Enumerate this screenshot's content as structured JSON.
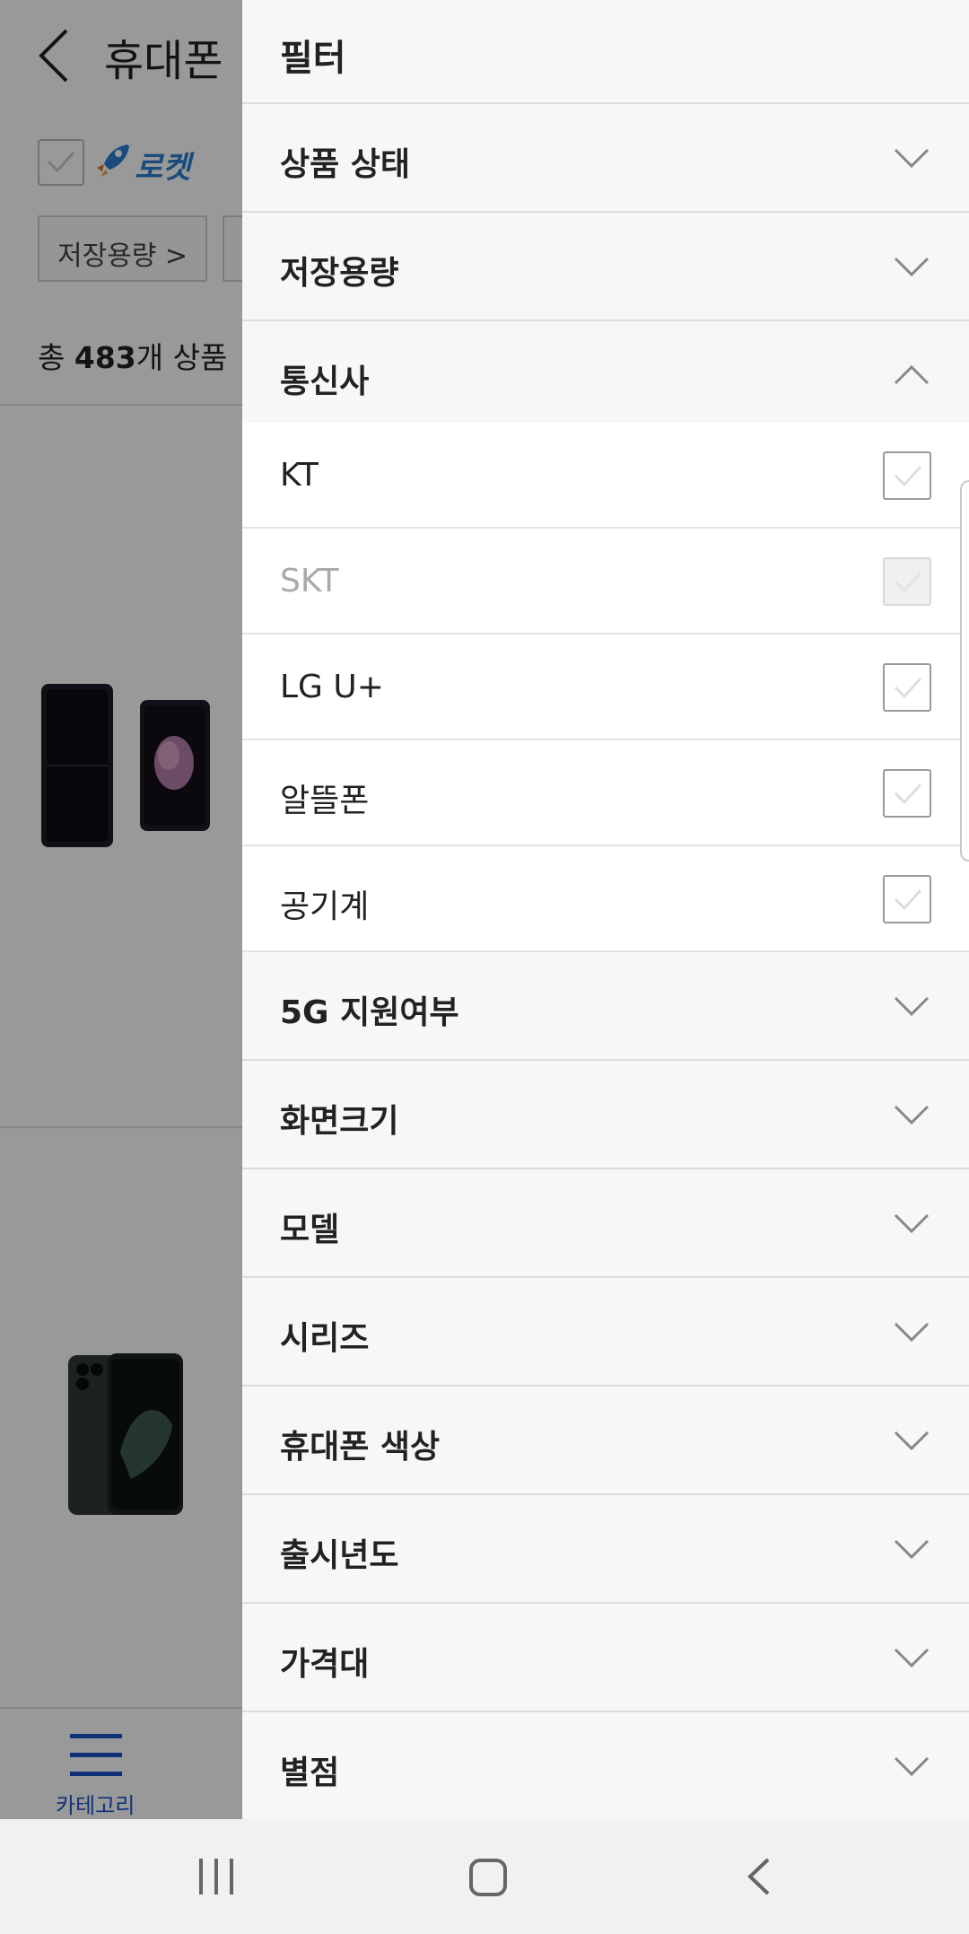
{
  "background_app": {
    "title": "휴대폰",
    "rocket_filter_label": "로켓",
    "filter_chip": "저장용량 >",
    "count_prefix": "총 ",
    "count_value": "483",
    "count_suffix": "개 상품",
    "bottom_tab_label": "카테고리",
    "accent_color": "#1a54c7"
  },
  "drawer": {
    "title": "필터",
    "sections": [
      {
        "label": "상품 상태",
        "expanded": false
      },
      {
        "label": "저장용량",
        "expanded": false
      },
      {
        "label": "통신사",
        "expanded": true
      },
      {
        "label": "5G 지원여부",
        "expanded": false
      },
      {
        "label": "화면크기",
        "expanded": false
      },
      {
        "label": "모델",
        "expanded": false
      },
      {
        "label": "시리즈",
        "expanded": false
      },
      {
        "label": "휴대폰 색상",
        "expanded": false
      },
      {
        "label": "출시년도",
        "expanded": false
      },
      {
        "label": "가격대",
        "expanded": false
      },
      {
        "label": "별점",
        "expanded": false
      }
    ],
    "carrier_options": [
      {
        "label": "KT",
        "checked": false,
        "disabled": false
      },
      {
        "label": "SKT",
        "checked": false,
        "disabled": true
      },
      {
        "label": "LG U+",
        "checked": false,
        "disabled": false
      },
      {
        "label": "알뜰폰",
        "checked": false,
        "disabled": false
      },
      {
        "label": "공기계",
        "checked": false,
        "disabled": false
      }
    ]
  },
  "icons": {
    "back": "back-arrow-icon",
    "chevron_down": "chevron-down-icon",
    "chevron_up": "chevron-up-icon",
    "checkmark": "checkmark-icon",
    "menu": "hamburger-menu-icon",
    "rocket": "rocket-icon"
  }
}
